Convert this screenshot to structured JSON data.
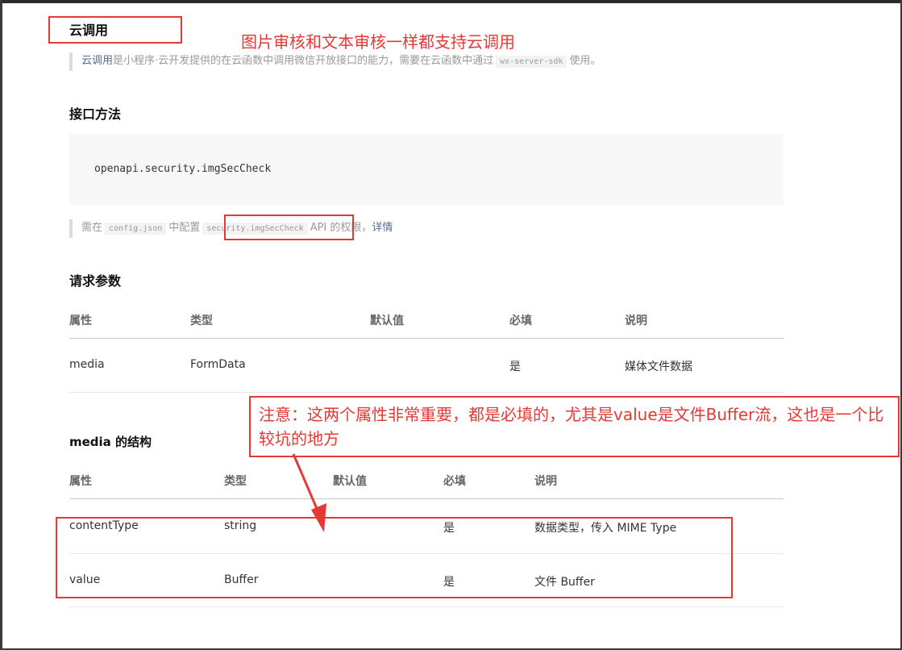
{
  "section_cloud": {
    "title": "云调用",
    "annotation": "图片审核和文本审核一样都支持云调用",
    "quote_link": "云调用",
    "quote_text": "是小程序·云开发提供的在云函数中调用微信开放接口的能力，需要在云函数中通过",
    "quote_code": "wx-server-sdk",
    "quote_tail": "使用。"
  },
  "interface": {
    "title": "接口方法",
    "code": "openapi.security.imgSecCheck"
  },
  "config_note": {
    "prefix": "需在",
    "code1": "config.json",
    "middle": "中配置",
    "code2": "security.imgSecCheck",
    "suffix": "API 的权限，",
    "link": "详情"
  },
  "request_params": {
    "title": "请求参数",
    "headers": [
      "属性",
      "类型",
      "默认值",
      "必填",
      "说明"
    ],
    "rows": [
      [
        "media",
        "FormData",
        "",
        "是",
        "媒体文件数据"
      ]
    ]
  },
  "annotation_note": "注意：这两个属性非常重要，都是必填的，尤其是value是文件Buffer流，这也是一个比较坑的地方",
  "media_struct": {
    "title": "media 的结构",
    "headers": [
      "属性",
      "类型",
      "默认值",
      "必填",
      "说明"
    ],
    "rows": [
      [
        "contentType",
        "string",
        "",
        "是",
        "数据类型，传入 MIME Type"
      ],
      [
        "value",
        "Buffer",
        "",
        "是",
        "文件 Buffer"
      ]
    ]
  },
  "colors": {
    "annotation_red": "#e53935",
    "link_blue": "#576b95"
  }
}
